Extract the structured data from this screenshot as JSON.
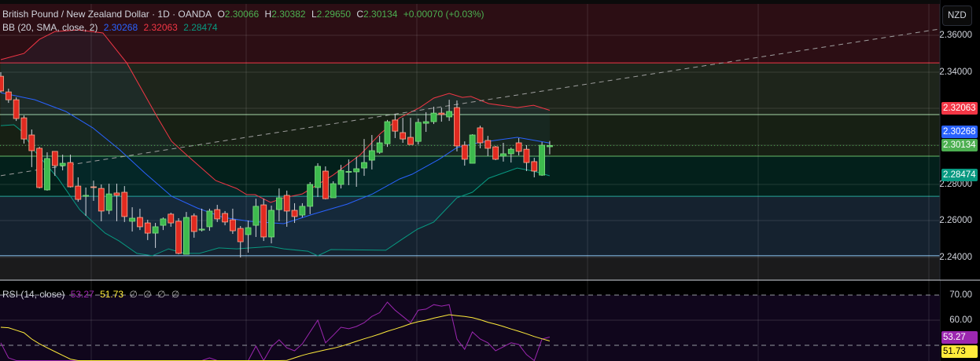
{
  "header": {
    "symbol": "British Pound / New Zealand Dollar · 1D · OANDA",
    "o_label": "O",
    "o": "2.30066",
    "h_label": "H",
    "h": "2.30382",
    "l_label": "L",
    "l": "2.29650",
    "c_label": "C",
    "c": "2.30134",
    "change": "+0.00070 (+0.03%)"
  },
  "bb": {
    "label": "BB (20, SMA, close, 2)",
    "basis": "2.30268",
    "upper": "2.32063",
    "lower": "2.28474"
  },
  "rsi": {
    "label": "RSI (14, close)",
    "value": "53.27",
    "ma": "51.73",
    "extras": [
      "∅",
      "∅",
      "∅",
      "∅"
    ]
  },
  "price_axis": {
    "currency": "NZD",
    "ticks": [
      "2.36000",
      "2.34000",
      "2.28000",
      "2.26000",
      "2.24000"
    ],
    "tags": {
      "upper": "2.32063",
      "basis": "2.30268",
      "last": "2.30134",
      "lower": "2.28474"
    }
  },
  "rsi_axis": {
    "ticks": [
      "70.00",
      "60.00"
    ],
    "tags": {
      "rsi": "53.27",
      "ma": "51.73"
    }
  },
  "colors": {
    "up": "#4caf50",
    "down": "#f23645",
    "basis": "#2962ff",
    "upper": "#f23645",
    "lower": "#089981",
    "rsi": "#9c27b0",
    "rsi_ma": "#ffeb3b"
  },
  "chart_data": {
    "type": "candlestick",
    "ohlc": [
      [
        2.3393,
        2.3415,
        2.3303,
        2.3312
      ],
      [
        2.3307,
        2.3325,
        2.3247,
        2.3264
      ],
      [
        2.3264,
        2.3277,
        2.3148,
        2.3161
      ],
      [
        2.3165,
        2.3178,
        2.3024,
        2.3049
      ],
      [
        2.3071,
        2.3101,
        2.2895,
        2.2985
      ],
      [
        2.2998,
        2.3006,
        2.2778,
        2.2783
      ],
      [
        2.277,
        2.2976,
        2.2766,
        2.2942
      ],
      [
        2.2981,
        2.2981,
        2.2847,
        2.2903
      ],
      [
        2.2903,
        2.2963,
        2.2877,
        2.2916
      ],
      [
        2.292,
        2.2963,
        2.2783,
        2.2787
      ],
      [
        2.2791,
        2.2839,
        2.2705,
        2.2718
      ],
      [
        2.2735,
        2.2783,
        2.2628,
        2.274
      ],
      [
        2.2787,
        2.2821,
        2.271,
        2.2783
      ],
      [
        2.2778,
        2.28,
        2.2598,
        2.2654
      ],
      [
        2.2658,
        2.2804,
        2.2637,
        2.2748
      ],
      [
        2.2753,
        2.2804,
        2.2598,
        2.274
      ],
      [
        2.2757,
        2.2791,
        2.2594,
        2.2624
      ],
      [
        2.2598,
        2.2675,
        2.2542,
        2.2615
      ],
      [
        2.2619,
        2.2667,
        2.255,
        2.2568
      ],
      [
        2.2589,
        2.2606,
        2.2495,
        2.2533
      ],
      [
        2.2533,
        2.2589,
        2.2452,
        2.2568
      ],
      [
        2.2576,
        2.2619,
        2.255,
        2.2611
      ],
      [
        2.2637,
        2.2645,
        2.2568,
        2.2589
      ],
      [
        2.2598,
        2.2615,
        2.2417,
        2.2422
      ],
      [
        2.2417,
        2.2649,
        2.2417,
        2.2619
      ],
      [
        2.2628,
        2.2641,
        2.2508,
        2.2542
      ],
      [
        2.255,
        2.2667,
        2.2542,
        2.2555
      ],
      [
        2.2568,
        2.2667,
        2.2546,
        2.2654
      ],
      [
        2.2662,
        2.2688,
        2.2594,
        2.2611
      ],
      [
        2.2641,
        2.2654,
        2.2576,
        2.2594
      ],
      [
        2.2606,
        2.2667,
        2.2529,
        2.2546
      ],
      [
        2.2559,
        2.2572,
        2.24,
        2.2486
      ],
      [
        2.2525,
        2.2602,
        2.2426,
        2.2563
      ],
      [
        2.2576,
        2.2722,
        2.2512,
        2.268
      ],
      [
        2.2688,
        2.2722,
        2.249,
        2.2512
      ],
      [
        2.2512,
        2.2684,
        2.2477,
        2.2658
      ],
      [
        2.2662,
        2.2778,
        2.2598,
        2.2727
      ],
      [
        2.274,
        2.2766,
        2.2568,
        2.2654
      ],
      [
        2.2658,
        2.2697,
        2.2589,
        2.2624
      ],
      [
        2.2632,
        2.2697,
        2.2619,
        2.268
      ],
      [
        2.268,
        2.2813,
        2.2637,
        2.28
      ],
      [
        2.2783,
        2.2916,
        2.2731,
        2.2899
      ],
      [
        2.2873,
        2.2899,
        2.2718,
        2.2722
      ],
      [
        2.2727,
        2.2817,
        2.2727,
        2.2804
      ],
      [
        2.28,
        2.2907,
        2.2778,
        2.2877
      ],
      [
        2.2869,
        2.2937,
        2.2796,
        2.2871
      ],
      [
        2.2869,
        2.295,
        2.2787,
        2.2886
      ],
      [
        2.289,
        2.3049,
        2.2847,
        2.292
      ],
      [
        2.2933,
        2.3071,
        2.2882,
        2.2985
      ],
      [
        2.2976,
        2.3066,
        2.2968,
        2.3028
      ],
      [
        2.3023,
        2.3153,
        2.3006,
        2.3144
      ],
      [
        2.3153,
        2.3187,
        2.3054,
        2.3092
      ],
      [
        2.3084,
        2.3165,
        2.3028,
        2.3049
      ],
      [
        2.3058,
        2.3165,
        2.3019,
        2.3019
      ],
      [
        2.3036,
        2.3161,
        2.3019,
        2.314
      ],
      [
        2.3135,
        2.3196,
        2.3088,
        2.3144
      ],
      [
        2.3144,
        2.3226,
        2.3131,
        2.3191
      ],
      [
        2.3191,
        2.3221,
        2.3144,
        2.3183
      ],
      [
        2.317,
        2.3264,
        2.3148,
        2.32
      ],
      [
        2.3221,
        2.326,
        2.2981,
        2.3011
      ],
      [
        2.3015,
        2.3036,
        2.2903,
        2.2938
      ],
      [
        2.2916,
        2.3075,
        2.2916,
        2.3071
      ],
      [
        2.311,
        2.3122,
        2.2998,
        2.3028
      ],
      [
        2.3041,
        2.3066,
        2.2955,
        2.2998
      ],
      [
        2.3006,
        2.3011,
        2.2933,
        2.2938
      ],
      [
        2.2955,
        2.3028,
        2.2925,
        2.2968
      ],
      [
        2.2968,
        2.3002,
        2.292,
        2.2993
      ],
      [
        2.3028,
        2.3054,
        2.2959,
        2.2981
      ],
      [
        2.2993,
        2.3015,
        2.2873,
        2.292
      ],
      [
        2.2925,
        2.2946,
        2.2839,
        2.2873
      ],
      [
        2.2851,
        2.3032,
        2.2847,
        2.3015
      ],
      [
        2.30066,
        2.30382,
        2.2965,
        2.30134
      ]
    ],
    "bb_basis": [
      [
        0,
        2.3303
      ],
      [
        4.4,
        2.3264
      ],
      [
        8.4,
        2.32
      ],
      [
        11.9,
        2.311
      ],
      [
        15.3,
        2.2993
      ],
      [
        18.6,
        2.2864
      ],
      [
        22.1,
        2.2735
      ],
      [
        25.4,
        2.2671
      ],
      [
        28.8,
        2.2619
      ],
      [
        32.2,
        2.2598
      ],
      [
        36.6,
        2.2585
      ],
      [
        40.4,
        2.2637
      ],
      [
        44.8,
        2.2692
      ],
      [
        48.1,
        2.2748
      ],
      [
        51.6,
        2.283
      ],
      [
        53.2,
        2.2856
      ],
      [
        56.7,
        2.2938
      ],
      [
        59,
        2.3002
      ],
      [
        61.7,
        2.3028
      ],
      [
        66.8,
        2.3058
      ],
      [
        71,
        2.30268
      ]
    ],
    "bb_upper": [
      [
        0,
        2.3484
      ],
      [
        3,
        2.3518
      ],
      [
        5,
        2.3595
      ],
      [
        7,
        2.3638
      ],
      [
        10,
        2.3647
      ],
      [
        13.2,
        2.363
      ],
      [
        16.3,
        2.3466
      ],
      [
        20.3,
        2.3165
      ],
      [
        22.1,
        2.3036
      ],
      [
        24.1,
        2.2959
      ],
      [
        27.8,
        2.2821
      ],
      [
        30.5,
        2.2778
      ],
      [
        31.8,
        2.2744
      ],
      [
        32.9,
        2.2744
      ],
      [
        34.9,
        2.2701
      ],
      [
        36.6,
        2.2727
      ],
      [
        39,
        2.2748
      ],
      [
        43,
        2.2852
      ],
      [
        46.5,
        2.2963
      ],
      [
        49.1,
        2.3079
      ],
      [
        51.6,
        2.3165
      ],
      [
        54.2,
        2.3221
      ],
      [
        56,
        2.3273
      ],
      [
        58,
        2.3299
      ],
      [
        59.7,
        2.3277
      ],
      [
        60.8,
        2.3282
      ],
      [
        63.1,
        2.3243
      ],
      [
        66.8,
        2.3221
      ],
      [
        68.9,
        2.3234
      ],
      [
        71,
        2.32063
      ]
    ],
    "bb_lower": [
      [
        0,
        2.3122
      ],
      [
        1.7,
        2.3127
      ],
      [
        2.7,
        2.3092
      ],
      [
        4.4,
        2.2981
      ],
      [
        7.4,
        2.2834
      ],
      [
        10.2,
        2.2662
      ],
      [
        11.9,
        2.2594
      ],
      [
        13.5,
        2.2533
      ],
      [
        15.3,
        2.249
      ],
      [
        17.6,
        2.2422
      ],
      [
        19.6,
        2.2409
      ],
      [
        21.7,
        2.2447
      ],
      [
        23.7,
        2.2422
      ],
      [
        25.7,
        2.2422
      ],
      [
        28.2,
        2.2452
      ],
      [
        30.5,
        2.2447
      ],
      [
        34.9,
        2.246
      ],
      [
        36.6,
        2.2447
      ],
      [
        39.7,
        2.2434
      ],
      [
        41,
        2.2409
      ],
      [
        42.7,
        2.2443
      ],
      [
        49.8,
        2.2439
      ],
      [
        52.2,
        2.2508
      ],
      [
        53.9,
        2.2555
      ],
      [
        56,
        2.2594
      ],
      [
        59,
        2.2727
      ],
      [
        61,
        2.2757
      ],
      [
        63.1,
        2.2834
      ],
      [
        66.8,
        2.289
      ],
      [
        68.9,
        2.2873
      ],
      [
        71,
        2.28474
      ]
    ],
    "zones": [
      2.3466,
      2.3183,
      2.2955,
      2.2735,
      2.2409
    ],
    "trendline": [
      [
        0,
        2.2848
      ],
      [
        121.5,
        2.3652
      ]
    ],
    "rsi": [
      51,
      45,
      42,
      38,
      36,
      32,
      38,
      36,
      37,
      33,
      31,
      32,
      32,
      30,
      34,
      34,
      31,
      30,
      29,
      28,
      31,
      33,
      32,
      28,
      36,
      34,
      35,
      45,
      42,
      41,
      39,
      36,
      40,
      49.7,
      40,
      49.4,
      52.2,
      49,
      47.8,
      50.6,
      55.3,
      60,
      51,
      54,
      57.2,
      56.6,
      57.5,
      59,
      61.5,
      63,
      67.2,
      64,
      61.5,
      59,
      64,
      64.4,
      66.2,
      65.6,
      66.2,
      52.5,
      48.4,
      55.3,
      52.5,
      51,
      47.8,
      49.4,
      51,
      50.3,
      46.3,
      43,
      52.5,
      53.27
    ],
    "rsi_ma": [
      57.2,
      57,
      56,
      55,
      52.5,
      50.6,
      49,
      47.5,
      46,
      44.5,
      43.5,
      43,
      42,
      41.5,
      41,
      40.5,
      40,
      39.5,
      39,
      38.5,
      38,
      37.5,
      37,
      36.5,
      36,
      36,
      36,
      36.5,
      37,
      37.5,
      38,
      38.5,
      39.5,
      40.5,
      41.5,
      42.5,
      43.3,
      44,
      45,
      46,
      46.8,
      47.5,
      48.2,
      48.8,
      49.6,
      50.6,
      51.6,
      52.6,
      53.5,
      54.5,
      55.6,
      56.5,
      57.5,
      58.6,
      59.4,
      60,
      60.8,
      61.5,
      62.2,
      61.8,
      61.5,
      61,
      60.2,
      59.2,
      58.4,
      57.5,
      56.5,
      55.6,
      54.6,
      53.5,
      52.6,
      51.73
    ],
    "rsi_levels": [
      70,
      50
    ]
  }
}
